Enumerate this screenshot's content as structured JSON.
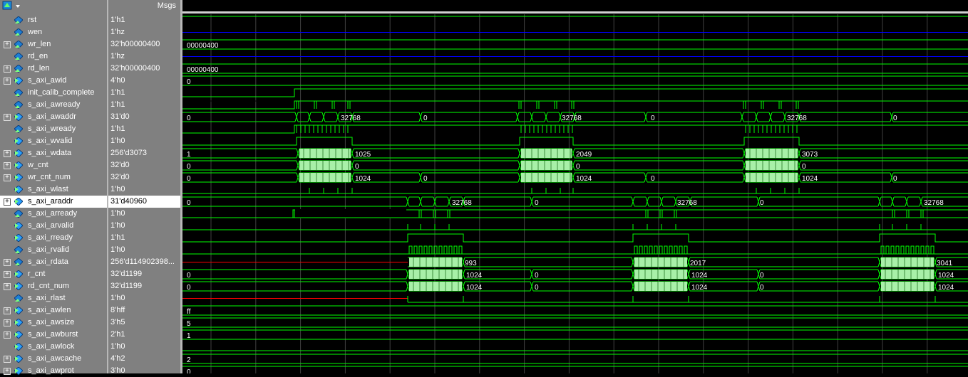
{
  "header": {
    "msgs_label": "Msgs"
  },
  "colors": {
    "wave_green": "#00ff00",
    "bus_fill": "#a8f0a8",
    "hiz_blue": "#0000ff",
    "undefined_red": "#ff0000",
    "panel_gray": "#808080",
    "grid": "#404040"
  },
  "signals": [
    {
      "name": "rst",
      "value": "1'h1",
      "expandable": false,
      "icon": "signal-input-icon"
    },
    {
      "name": "wen",
      "value": "1'hz",
      "expandable": false,
      "icon": "signal-input-icon"
    },
    {
      "name": "wr_len",
      "value": "32'h00000400",
      "expandable": true,
      "icon": "signal-input-icon"
    },
    {
      "name": "rd_en",
      "value": "1'hz",
      "expandable": false,
      "icon": "signal-input-icon"
    },
    {
      "name": "rd_len",
      "value": "32'h00000400",
      "expandable": true,
      "icon": "signal-input-icon"
    },
    {
      "name": "s_axi_awid",
      "value": "4'h0",
      "expandable": true,
      "icon": "signal-output-icon"
    },
    {
      "name": "init_calib_complete",
      "value": "1'h1",
      "expandable": false,
      "icon": "signal-input-icon"
    },
    {
      "name": "s_axi_awready",
      "value": "1'h1",
      "expandable": false,
      "icon": "signal-input-icon"
    },
    {
      "name": "s_axi_awaddr",
      "value": "31'd0",
      "expandable": true,
      "icon": "signal-output-icon"
    },
    {
      "name": "s_axi_wready",
      "value": "1'h1",
      "expandable": false,
      "icon": "signal-input-icon"
    },
    {
      "name": "s_axi_wvalid",
      "value": "1'h0",
      "expandable": false,
      "icon": "signal-output-icon"
    },
    {
      "name": "s_axi_wdata",
      "value": "256'd3073",
      "expandable": true,
      "icon": "signal-output-icon"
    },
    {
      "name": "w_cnt",
      "value": "32'd0",
      "expandable": true,
      "icon": "signal-output-icon"
    },
    {
      "name": "wr_cnt_num",
      "value": "32'd0",
      "expandable": true,
      "icon": "signal-output-icon"
    },
    {
      "name": "s_axi_wlast",
      "value": "1'h0",
      "expandable": false,
      "icon": "signal-output-icon"
    },
    {
      "name": "s_axi_araddr",
      "value": "31'd40960",
      "expandable": true,
      "icon": "signal-output-icon",
      "selected": true
    },
    {
      "name": "s_axi_arready",
      "value": "1'h0",
      "expandable": false,
      "icon": "signal-input-icon"
    },
    {
      "name": "s_axi_arvalid",
      "value": "1'h0",
      "expandable": false,
      "icon": "signal-output-icon"
    },
    {
      "name": "s_axi_rready",
      "value": "1'h1",
      "expandable": false,
      "icon": "signal-output-icon"
    },
    {
      "name": "s_axi_rvalid",
      "value": "1'h0",
      "expandable": false,
      "icon": "signal-input-icon"
    },
    {
      "name": "s_axi_rdata",
      "value": "256'd114902398...",
      "expandable": true,
      "icon": "signal-input-icon"
    },
    {
      "name": "r_cnt",
      "value": "32'd1199",
      "expandable": true,
      "icon": "signal-output-icon"
    },
    {
      "name": "rd_cnt_num",
      "value": "32'd1199",
      "expandable": true,
      "icon": "signal-output-icon"
    },
    {
      "name": "s_axi_rlast",
      "value": "1'h0",
      "expandable": false,
      "icon": "signal-input-icon"
    },
    {
      "name": "s_axi_awlen",
      "value": "8'hff",
      "expandable": true,
      "icon": "signal-output-icon"
    },
    {
      "name": "s_axi_awsize",
      "value": "3'h5",
      "expandable": true,
      "icon": "signal-output-icon"
    },
    {
      "name": "s_axi_awburst",
      "value": "2'h1",
      "expandable": true,
      "icon": "signal-output-icon"
    },
    {
      "name": "s_axi_awlock",
      "value": "1'h0",
      "expandable": false,
      "icon": "signal-output-icon"
    },
    {
      "name": "s_axi_awcache",
      "value": "4'h2",
      "expandable": true,
      "icon": "signal-output-icon"
    },
    {
      "name": "s_axi_awprot",
      "value": "3'h0",
      "expandable": true,
      "icon": "signal-output-icon"
    }
  ],
  "bus_labels": {
    "wr_len": [
      "00000400"
    ],
    "rd_len": [
      "00000400"
    ],
    "s_axi_awid": [
      "0"
    ],
    "s_axi_awaddr": [
      "0",
      "32768",
      "0",
      "32768",
      "0",
      "32768",
      "0"
    ],
    "s_axi_wdata": [
      "1",
      "1025",
      "2049",
      "3073"
    ],
    "w_cnt": [
      "0",
      "0",
      "0",
      "0"
    ],
    "wr_cnt_num": [
      "0",
      "1024",
      "0",
      "1024",
      "0",
      "1024",
      "0"
    ],
    "s_axi_araddr": [
      "0",
      "32768",
      "0",
      "32768",
      "0",
      "32768"
    ],
    "s_axi_rdata": [
      "993",
      "2017",
      "3041"
    ],
    "r_cnt": [
      "0",
      "1024",
      "0",
      "1024",
      "0",
      "1024"
    ],
    "rd_cnt_num": [
      "0",
      "1024",
      "0",
      "1024",
      "0",
      "1024"
    ],
    "s_axi_awlen": [
      "ff"
    ],
    "s_axi_awsize": [
      "5"
    ],
    "s_axi_awburst": [
      "1"
    ],
    "s_axi_awcache": [
      "2"
    ],
    "s_axi_awprot": [
      "0"
    ]
  }
}
